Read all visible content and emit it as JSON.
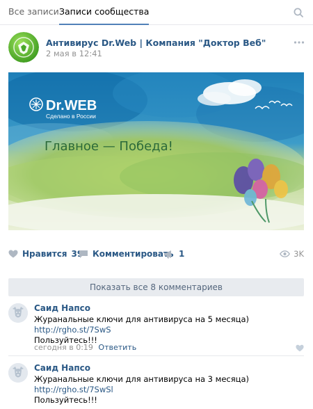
{
  "tabs": [
    {
      "label": "Все записи"
    },
    {
      "label": "Записи сообщества"
    }
  ],
  "post": {
    "author": "Антивирус Dr.Web | Компания \"Доктор Веб\"",
    "date": "2 мая в 12:41",
    "image": {
      "logo_text": "Dr.WEB",
      "logo_sub": "Сделано в России",
      "headline": "Главное — Победа!"
    },
    "actions": {
      "like_label": "Нравится",
      "like_count": "39",
      "comment_label": "Комментировать",
      "share_count": "1",
      "views": "3K"
    }
  },
  "show_all_label": "Показать все 8 комментариев",
  "comments": [
    {
      "name": "Саид Напсо",
      "text": "Журанальные ключи для антивируса на 5 месяца)",
      "link": "http://rgho.st/7SwS",
      "tail": "Пользуйтесь!!!",
      "time": "сегодня в 0:19",
      "reply": "Ответить"
    },
    {
      "name": "Саид Напсо",
      "text": "Журанальные ключи для антивируса на 3 месяца)",
      "link": "http://rgho.st/7SwSl",
      "tail": "Пользуйтесь!!!"
    }
  ],
  "colors": {
    "link": "#2a5885",
    "muted": "#939393",
    "accent": "#5181b8",
    "logo_green": "#5db32f"
  }
}
